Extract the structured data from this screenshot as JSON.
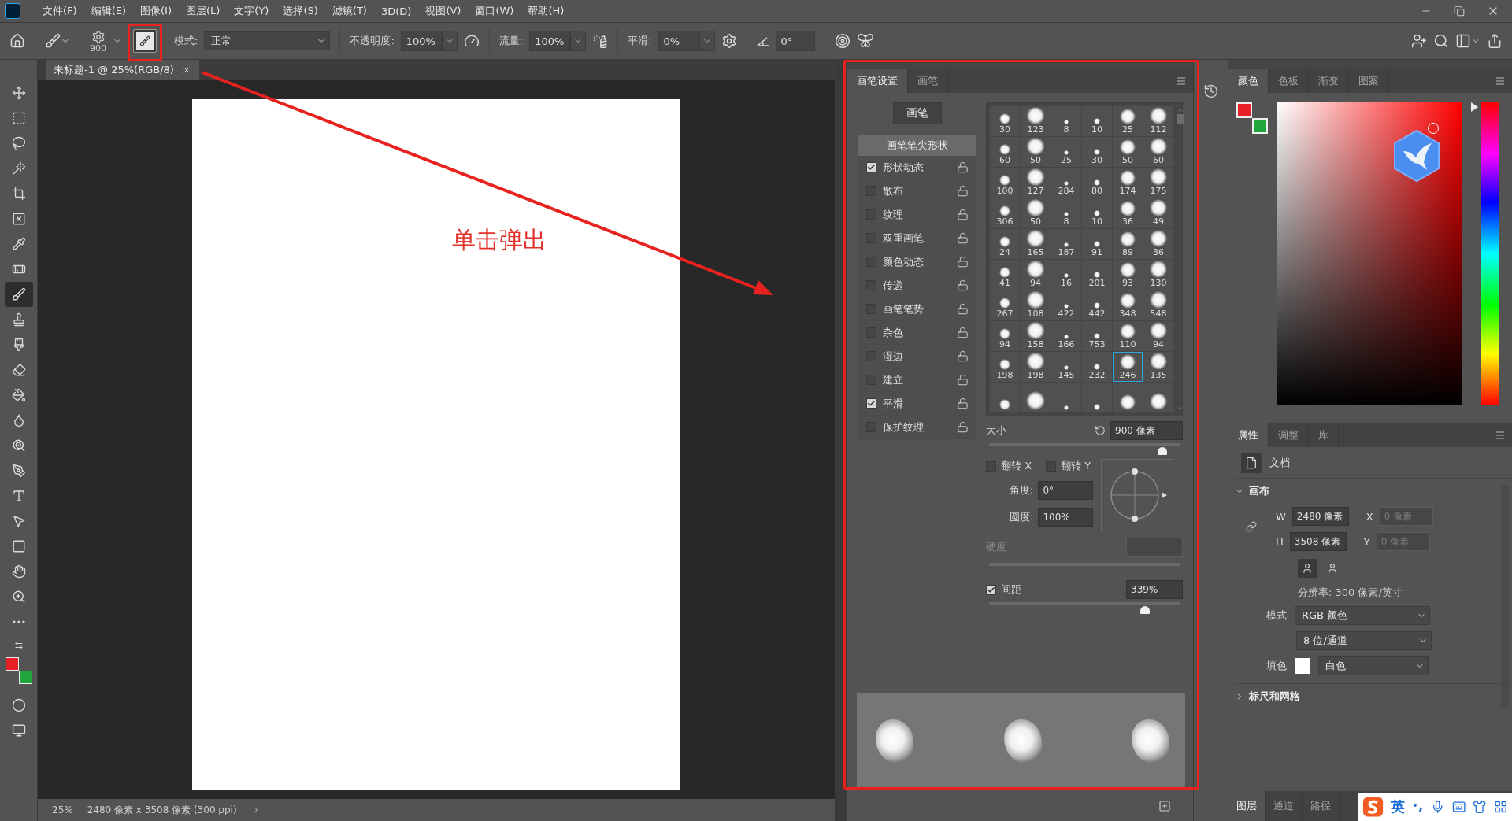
{
  "menu_bar": {
    "items": [
      "文件(F)",
      "编辑(E)",
      "图像(I)",
      "图层(L)",
      "文字(Y)",
      "选择(S)",
      "滤镜(T)",
      "3D(D)",
      "视图(V)",
      "窗口(W)",
      "帮助(H)"
    ]
  },
  "options_bar": {
    "brush_size": "900",
    "brush_settings_toggle": {
      "on": true
    },
    "mode_label": "模式:",
    "mode": "正常",
    "opacity_label": "不透明度:",
    "opacity": "100%",
    "flow_label": "流量:",
    "flow": "100%",
    "smoothing_label": "平滑:",
    "smoothing": "0%",
    "angle": "0°"
  },
  "document_tab": {
    "title": "未标题-1 @ 25%(RGB/8)"
  },
  "tools": [
    {
      "selected": false
    },
    {
      "selected": false
    },
    {
      "selected": false
    },
    {
      "selected": false
    },
    {
      "selected": false
    },
    {
      "selected": false
    },
    {
      "selected": false
    },
    {
      "selected": false
    },
    {
      "selected": true
    },
    {
      "selected": false
    },
    {
      "selected": false
    },
    {
      "selected": false
    },
    {
      "selected": false
    },
    {
      "selected": false
    },
    {
      "selected": false
    },
    {
      "selected": false
    },
    {
      "selected": false
    },
    {
      "selected": false
    },
    {
      "selected": false
    },
    {
      "selected": false
    },
    {
      "selected": false
    },
    {
      "selected": false
    }
  ],
  "colors": {
    "foreground": {
      "color": "#e8202a"
    },
    "background": {
      "color": "#1fa53a"
    }
  },
  "status_bar": {
    "zoom": "25%",
    "info": "2480 像素 x 3508 像素 (300 ppi)"
  },
  "annotation": {
    "text": "单击弹出"
  },
  "brush_panel": {
    "tabs": [
      {
        "label": "画笔设置",
        "selected": true
      },
      {
        "label": "画笔",
        "selected": false
      }
    ],
    "brushes_button": "画笔",
    "options": [
      {
        "kind": "header",
        "label": "画笔笔尖形状",
        "selected": true
      },
      {
        "kind": "option",
        "label": "形状动态",
        "checked": true,
        "selected": false
      },
      {
        "kind": "option",
        "label": "散布",
        "checked": false,
        "selected": false
      },
      {
        "kind": "option",
        "label": "纹理",
        "checked": false,
        "selected": false
      },
      {
        "kind": "option",
        "label": "双重画笔",
        "checked": false,
        "selected": false
      },
      {
        "kind": "option",
        "label": "颜色动态",
        "checked": false,
        "selected": false
      },
      {
        "kind": "option",
        "label": "传递",
        "checked": false,
        "selected": false
      },
      {
        "kind": "option",
        "label": "画笔笔势",
        "checked": false,
        "selected": false
      },
      {
        "kind": "option",
        "label": "杂色",
        "checked": false,
        "selected": false
      },
      {
        "kind": "option",
        "label": "湿边",
        "checked": false,
        "selected": false
      },
      {
        "kind": "option",
        "label": "建立",
        "checked": false,
        "selected": false
      },
      {
        "kind": "option",
        "label": "平滑",
        "checked": true,
        "selected": false
      },
      {
        "kind": "option",
        "label": "保护纹理",
        "checked": false,
        "selected": false
      }
    ],
    "tips": [
      {
        "size": "30",
        "selected": false
      },
      {
        "size": "123",
        "selected": false
      },
      {
        "size": "8",
        "selected": false
      },
      {
        "size": "10",
        "selected": false
      },
      {
        "size": "25",
        "selected": false
      },
      {
        "size": "112",
        "selected": false
      },
      {
        "size": "60",
        "selected": false
      },
      {
        "size": "50",
        "selected": false
      },
      {
        "size": "25",
        "selected": false
      },
      {
        "size": "30",
        "selected": false
      },
      {
        "size": "50",
        "selected": false
      },
      {
        "size": "60",
        "selected": false
      },
      {
        "size": "100",
        "selected": false
      },
      {
        "size": "127",
        "selected": false
      },
      {
        "size": "284",
        "selected": false
      },
      {
        "size": "80",
        "selected": false
      },
      {
        "size": "174",
        "selected": false
      },
      {
        "size": "175",
        "selected": false
      },
      {
        "size": "306",
        "selected": false
      },
      {
        "size": "50",
        "selected": false
      },
      {
        "size": "8",
        "selected": false
      },
      {
        "size": "10",
        "selected": false
      },
      {
        "size": "36",
        "selected": false
      },
      {
        "size": "49",
        "selected": false
      },
      {
        "size": "24",
        "selected": false
      },
      {
        "size": "165",
        "selected": false
      },
      {
        "size": "187",
        "selected": false
      },
      {
        "size": "91",
        "selected": false
      },
      {
        "size": "89",
        "selected": false
      },
      {
        "size": "36",
        "selected": false
      },
      {
        "size": "41",
        "selected": false
      },
      {
        "size": "94",
        "selected": false
      },
      {
        "size": "16",
        "selected": false
      },
      {
        "size": "201",
        "selected": false
      },
      {
        "size": "93",
        "selected": false
      },
      {
        "size": "130",
        "selected": false
      },
      {
        "size": "267",
        "selected": false
      },
      {
        "size": "108",
        "selected": false
      },
      {
        "size": "422",
        "selected": false
      },
      {
        "size": "442",
        "selected": false
      },
      {
        "size": "348",
        "selected": false
      },
      {
        "size": "548",
        "selected": false
      },
      {
        "size": "94",
        "selected": false
      },
      {
        "size": "158",
        "selected": false
      },
      {
        "size": "166",
        "selected": false
      },
      {
        "size": "753",
        "selected": false
      },
      {
        "size": "110",
        "selected": false
      },
      {
        "size": "94",
        "selected": false
      },
      {
        "size": "198",
        "selected": false
      },
      {
        "size": "198",
        "selected": false
      },
      {
        "size": "145",
        "selected": false
      },
      {
        "size": "232",
        "selected": false
      },
      {
        "size": "246",
        "selected": true
      },
      {
        "size": "135",
        "selected": false
      },
      {
        "selected": false
      },
      {
        "selected": false
      },
      {
        "selected": false
      },
      {
        "selected": false
      },
      {
        "selected": false
      },
      {
        "selected": false
      }
    ],
    "size": {
      "label": "大小",
      "value": "900 像素",
      "level": 0.91
    },
    "flip_x": {
      "label": "翻转 X",
      "checked": false
    },
    "flip_y": {
      "label": "翻转 Y",
      "checked": false
    },
    "angle": {
      "label": "角度:",
      "value": "0°"
    },
    "roundness": {
      "label": "圆度:",
      "value": "100%"
    },
    "hardness": {
      "label": "硬度",
      "disabled": true
    },
    "spacing": {
      "label": "间距",
      "checked": true,
      "value": "339%",
      "level": 0.82
    }
  },
  "color_panel": {
    "hue": {
      "level": 1
    },
    "tabs": [
      {
        "label": "颜色",
        "selected": true
      },
      {
        "label": "色板",
        "selected": false
      },
      {
        "label": "渐变",
        "selected": false
      },
      {
        "label": "图案",
        "selected": false
      }
    ]
  },
  "properties_panel": {
    "tabs": [
      {
        "label": "属性",
        "selected": true
      },
      {
        "label": "调整",
        "selected": false
      },
      {
        "label": "库",
        "selected": false
      }
    ],
    "kind": "文档",
    "section": "画布",
    "w_label": "W",
    "w": "2480 像素",
    "x_label": "X",
    "x": "0 像素",
    "h_label": "H",
    "h": "3508 像素",
    "y_label": "Y",
    "y": "0 像素",
    "orientations": [
      {
        "selected": true
      },
      {
        "selected": false
      }
    ],
    "resolution": "分辨率: 300 像素/英寸",
    "mode_label": "模式",
    "mode": "RGB 颜色",
    "depth": "8 位/通道",
    "fill_label": "填色",
    "fill": "白色",
    "next_section": "标尺和网格"
  },
  "layers_panel": {
    "tabs": [
      {
        "label": "图层",
        "selected": true
      },
      {
        "label": "通道",
        "selected": false
      },
      {
        "label": "路径",
        "selected": false
      }
    ]
  },
  "ime_bar": {
    "mode": "英"
  }
}
